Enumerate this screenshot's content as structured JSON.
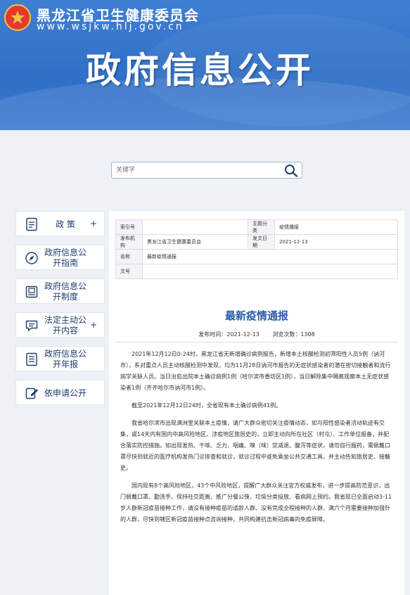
{
  "header": {
    "org_name": "黑龙江省卫生健康委员会",
    "org_url": "www.wsjkw.hlj.gov.cn",
    "page_title": "政府信息公开"
  },
  "search": {
    "placeholder": "关键字"
  },
  "sidebar": {
    "items": [
      {
        "label": "政 策",
        "icon": "document-icon",
        "plus": "+"
      },
      {
        "label": "政府信息公开指南",
        "icon": "compass-icon",
        "plus": ""
      },
      {
        "label": "政府信息公开制度",
        "icon": "book-icon",
        "plus": ""
      },
      {
        "label": "法定主动公开内容",
        "icon": "chat-icon",
        "plus": "+"
      },
      {
        "label": "政府信息公开年报",
        "icon": "report-icon",
        "plus": ""
      },
      {
        "label": "依申请公开",
        "icon": "edit-icon",
        "plus": ""
      }
    ]
  },
  "meta": {
    "index_label": "索引号",
    "index_value": "",
    "topic_label": "主题分类",
    "topic_value": "疫情播报",
    "publisher_label": "发布机构",
    "publisher_value": "黑龙江省卫生健康委员会",
    "date_label": "发文日期",
    "date_value": "2021-12-13",
    "name_label": "名称",
    "name_value": "最新疫情通报",
    "docno_label": "文号",
    "docno_value": ""
  },
  "article": {
    "title": "最新疫情通报",
    "publish_time": "发布时间：2021-12-13",
    "views": "浏览次数：1308",
    "paragraphs": [
      "2021年12月12日0-24时，黑龙江省无新增确诊病例报告，新增本土核酸检测初筛阳性人员5例（讷河市），系对重点人员主动核酸检测中发现，均为11月28日讷河市报告的无症状感染者的潜在密切接触者和流行病学关联人员。当日治愈出院本土确诊病例1例（哈尔滨市香坊区1例），当日解除集中隔离观察本土无症状感染者1例（齐齐哈尔市讷河市1例）。",
      "截至2021年12月12日24时，全省现有本土确诊病例41例。",
      "我省哈尔滨市出现满洲里关联本土疫情，请广大群众密切关注疫情动态，如与阳性感染者活动轨迹有交集，或14天内有国内中高风险地区、涉疫地区旅居史的，立即主动向所在社区（村屯）、工作单位报备，并配合落实防控措施。如出现发热、干咳、乏力、咽痛、嗅（味）觉减退、腹泻等症状，请勿自行服药，需佩戴口罩尽快到就近的医疗机构发热门诊排查和就诊，就诊过程中谁免乘坐公共交通工具，并主动告知旅居史、接触史。",
      "国内现有8个高风险地区，43个中风险地区，提醒广大群众关注官方权威发布，进一步提高防范意识，出门佩戴口罩、勤洗手、保持社交距离、推广分餐公筷、垃圾分类投放、看病网上预约。我省现已全面启动3-11岁人群新冠疫苗接种工作，请没有接种疫苗的适龄人群、没有完成全程接种的人群、满六个月需要接种加强针的人群，尽快到辖区新冠疫苗接种点咨询接种，共同构建抗击新冠病毒的免疫屏障。"
    ]
  },
  "colors": {
    "banner": "#2f6fc7",
    "nav_text": "#1d3c6e",
    "title": "#2a5aa8"
  }
}
